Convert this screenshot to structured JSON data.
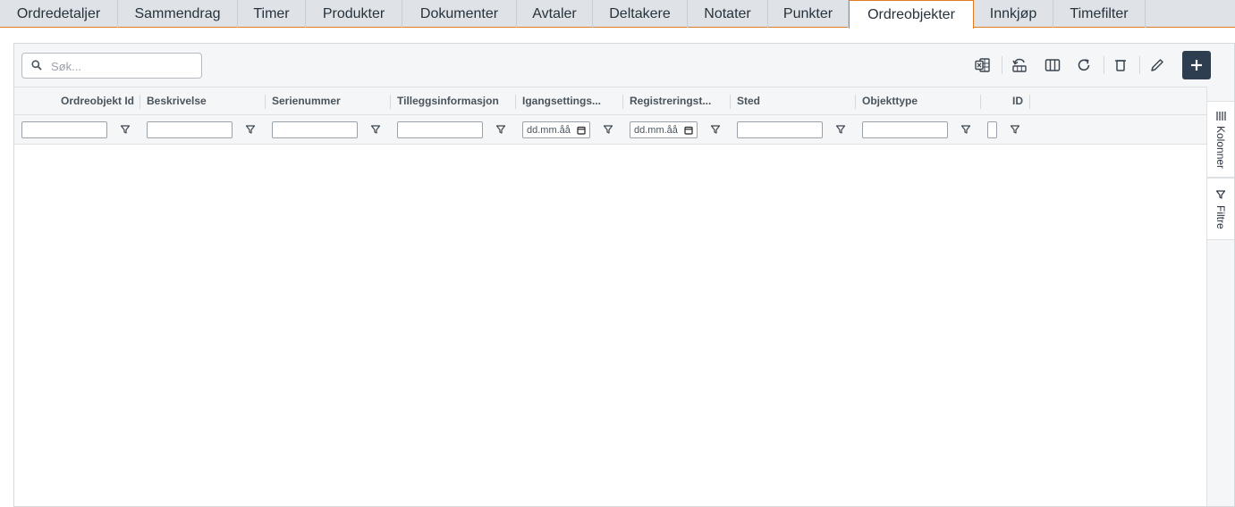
{
  "tabs": [
    {
      "label": "Ordredetaljer"
    },
    {
      "label": "Sammendrag"
    },
    {
      "label": "Timer"
    },
    {
      "label": "Produkter"
    },
    {
      "label": "Dokumenter"
    },
    {
      "label": "Avtaler"
    },
    {
      "label": "Deltakere"
    },
    {
      "label": "Notater"
    },
    {
      "label": "Punkter"
    },
    {
      "label": "Ordreobjekter",
      "active": true
    },
    {
      "label": "Innkjøp"
    },
    {
      "label": "Timefilter"
    }
  ],
  "search": {
    "placeholder": "Søk..."
  },
  "toolbar": {
    "icons": [
      "excel-export-icon",
      "undo-layout-icon",
      "columns-icon",
      "refresh-icon",
      "delete-icon",
      "edit-icon",
      "add-icon"
    ]
  },
  "columns": [
    {
      "label": "Ordreobjekt Id"
    },
    {
      "label": "Beskrivelse"
    },
    {
      "label": "Serienummer"
    },
    {
      "label": "Tilleggsinformasjon"
    },
    {
      "label": "Igangsettings..."
    },
    {
      "label": "Registreringst..."
    },
    {
      "label": "Sted"
    },
    {
      "label": "Objekttype"
    },
    {
      "label": "ID"
    }
  ],
  "filters": {
    "date_placeholder_1": "dd.mm.åå",
    "date_placeholder_2": "dd.mm.åå"
  },
  "side_panel": {
    "columns_label": "Kolonner",
    "filters_label": "Filtre"
  },
  "colors": {
    "accent": "#e07b24",
    "primary_button": "#2c3e50"
  }
}
